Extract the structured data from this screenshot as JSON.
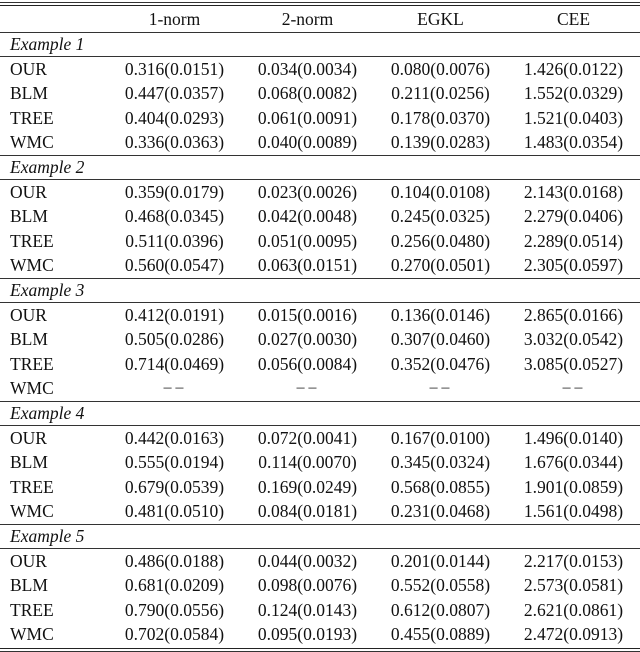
{
  "table": {
    "columns": [
      "",
      "1-norm",
      "2-norm",
      "EGKL",
      "CEE"
    ],
    "missing_marker": "−−",
    "sections": [
      {
        "title": "Example 1",
        "rows": [
          {
            "method": "OUR",
            "values": [
              "0.316(0.0151)",
              "0.034(0.0034)",
              "0.080(0.0076)",
              "1.426(0.0122)"
            ]
          },
          {
            "method": "BLM",
            "values": [
              "0.447(0.0357)",
              "0.068(0.0082)",
              "0.211(0.0256)",
              "1.552(0.0329)"
            ]
          },
          {
            "method": "TREE",
            "values": [
              "0.404(0.0293)",
              "0.061(0.0091)",
              "0.178(0.0370)",
              "1.521(0.0403)"
            ]
          },
          {
            "method": "WMC",
            "values": [
              "0.336(0.0363)",
              "0.040(0.0089)",
              "0.139(0.0283)",
              "1.483(0.0354)"
            ]
          }
        ]
      },
      {
        "title": "Example 2",
        "rows": [
          {
            "method": "OUR",
            "values": [
              "0.359(0.0179)",
              "0.023(0.0026)",
              "0.104(0.0108)",
              "2.143(0.0168)"
            ]
          },
          {
            "method": "BLM",
            "values": [
              "0.468(0.0345)",
              "0.042(0.0048)",
              "0.245(0.0325)",
              "2.279(0.0406)"
            ]
          },
          {
            "method": "TREE",
            "values": [
              "0.511(0.0396)",
              "0.051(0.0095)",
              "0.256(0.0480)",
              "2.289(0.0514)"
            ]
          },
          {
            "method": "WMC",
            "values": [
              "0.560(0.0547)",
              "0.063(0.0151)",
              "0.270(0.0501)",
              "2.305(0.0597)"
            ]
          }
        ]
      },
      {
        "title": "Example 3",
        "rows": [
          {
            "method": "OUR",
            "values": [
              "0.412(0.0191)",
              "0.015(0.0016)",
              "0.136(0.0146)",
              "2.865(0.0166)"
            ]
          },
          {
            "method": "BLM",
            "values": [
              "0.505(0.0286)",
              "0.027(0.0030)",
              "0.307(0.0460)",
              "3.032(0.0542)"
            ]
          },
          {
            "method": "TREE",
            "values": [
              "0.714(0.0469)",
              "0.056(0.0084)",
              "0.352(0.0476)",
              "3.085(0.0527)"
            ]
          },
          {
            "method": "WMC",
            "values": [
              "−−",
              "−−",
              "−−",
              "−−"
            ]
          }
        ]
      },
      {
        "title": "Example 4",
        "rows": [
          {
            "method": "OUR",
            "values": [
              "0.442(0.0163)",
              "0.072(0.0041)",
              "0.167(0.0100)",
              "1.496(0.0140)"
            ]
          },
          {
            "method": "BLM",
            "values": [
              "0.555(0.0194)",
              "0.114(0.0070)",
              "0.345(0.0324)",
              "1.676(0.0344)"
            ]
          },
          {
            "method": "TREE",
            "values": [
              "0.679(0.0539)",
              "0.169(0.0249)",
              "0.568(0.0855)",
              "1.901(0.0859)"
            ]
          },
          {
            "method": "WMC",
            "values": [
              "0.481(0.0510)",
              "0.084(0.0181)",
              "0.231(0.0468)",
              "1.561(0.0498)"
            ]
          }
        ]
      },
      {
        "title": "Example 5",
        "rows": [
          {
            "method": "OUR",
            "values": [
              "0.486(0.0188)",
              "0.044(0.0032)",
              "0.201(0.0144)",
              "2.217(0.0153)"
            ]
          },
          {
            "method": "BLM",
            "values": [
              "0.681(0.0209)",
              "0.098(0.0076)",
              "0.552(0.0558)",
              "2.573(0.0581)"
            ]
          },
          {
            "method": "TREE",
            "values": [
              "0.790(0.0556)",
              "0.124(0.0143)",
              "0.612(0.0807)",
              "2.621(0.0861)"
            ]
          },
          {
            "method": "WMC",
            "values": [
              "0.702(0.0584)",
              "0.095(0.0193)",
              "0.455(0.0889)",
              "2.472(0.0913)"
            ]
          }
        ]
      }
    ]
  }
}
